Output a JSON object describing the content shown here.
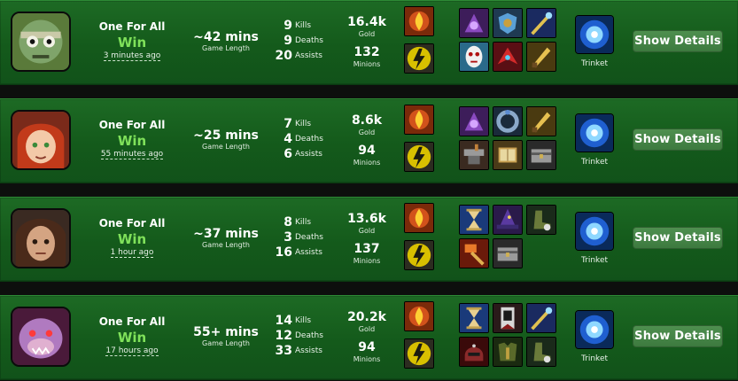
{
  "games": [
    {
      "champion": "Amumu",
      "mode": "One For All",
      "result": "Win",
      "ago": "3 minutes ago",
      "length": "~42 mins",
      "length_label": "Game Length",
      "kills": "9",
      "deaths": "9",
      "assists": "20",
      "gold": "16.4k",
      "minions": "132",
      "spells": [
        "ignite-icon",
        "flash-icon"
      ],
      "items": [
        "item-purple-icon",
        "item-blue-shield-icon",
        "item-staff-icon",
        "item-mask-icon",
        "item-red-wing-icon",
        "item-gold-blade-icon"
      ],
      "trinket_label": "Trinket",
      "button": "Show Details"
    },
    {
      "champion": "Annie",
      "mode": "One For All",
      "result": "Win",
      "ago": "55 minutes ago",
      "length": "~25 mins",
      "length_label": "Game Length",
      "kills": "7",
      "deaths": "4",
      "assists": "6",
      "gold": "8.6k",
      "minions": "94",
      "spells": [
        "ignite-icon",
        "flash-icon"
      ],
      "items": [
        "item-purple-icon",
        "item-ring-icon",
        "item-gold-blade-icon",
        "item-anvil-icon",
        "item-tome-icon",
        "item-chest-icon"
      ],
      "trinket_label": "Trinket",
      "button": "Show Details"
    },
    {
      "champion": "Vayne",
      "mode": "One For All",
      "result": "Win",
      "ago": "1 hour ago",
      "length": "~37 mins",
      "length_label": "Game Length",
      "kills": "8",
      "deaths": "3",
      "assists": "16",
      "gold": "13.6k",
      "minions": "137",
      "spells": [
        "ignite-icon",
        "flash-icon"
      ],
      "items": [
        "item-hourglass-icon",
        "item-wizard-hat-icon",
        "item-boots-icon",
        "item-hammer-icon",
        "item-chest-icon"
      ],
      "trinket_label": "Trinket",
      "button": "Show Details"
    },
    {
      "champion": "Warwick",
      "mode": "One For All",
      "result": "Win",
      "ago": "17 hours ago",
      "length": "55+ mins",
      "length_label": "Game Length",
      "kills": "14",
      "deaths": "12",
      "assists": "33",
      "gold": "20.2k",
      "minions": "94",
      "spells": [
        "ignite-icon",
        "flash-icon"
      ],
      "items": [
        "item-hourglass-icon",
        "item-banner-icon",
        "item-staff-icon",
        "item-helmet-icon",
        "item-armor-icon",
        "item-boots-icon"
      ],
      "trinket_label": "Trinket",
      "button": "Show Details"
    }
  ],
  "labels": {
    "kills": "Kills",
    "deaths": "Deaths",
    "assists": "Assists",
    "gold": "Gold",
    "minions": "Minions"
  }
}
